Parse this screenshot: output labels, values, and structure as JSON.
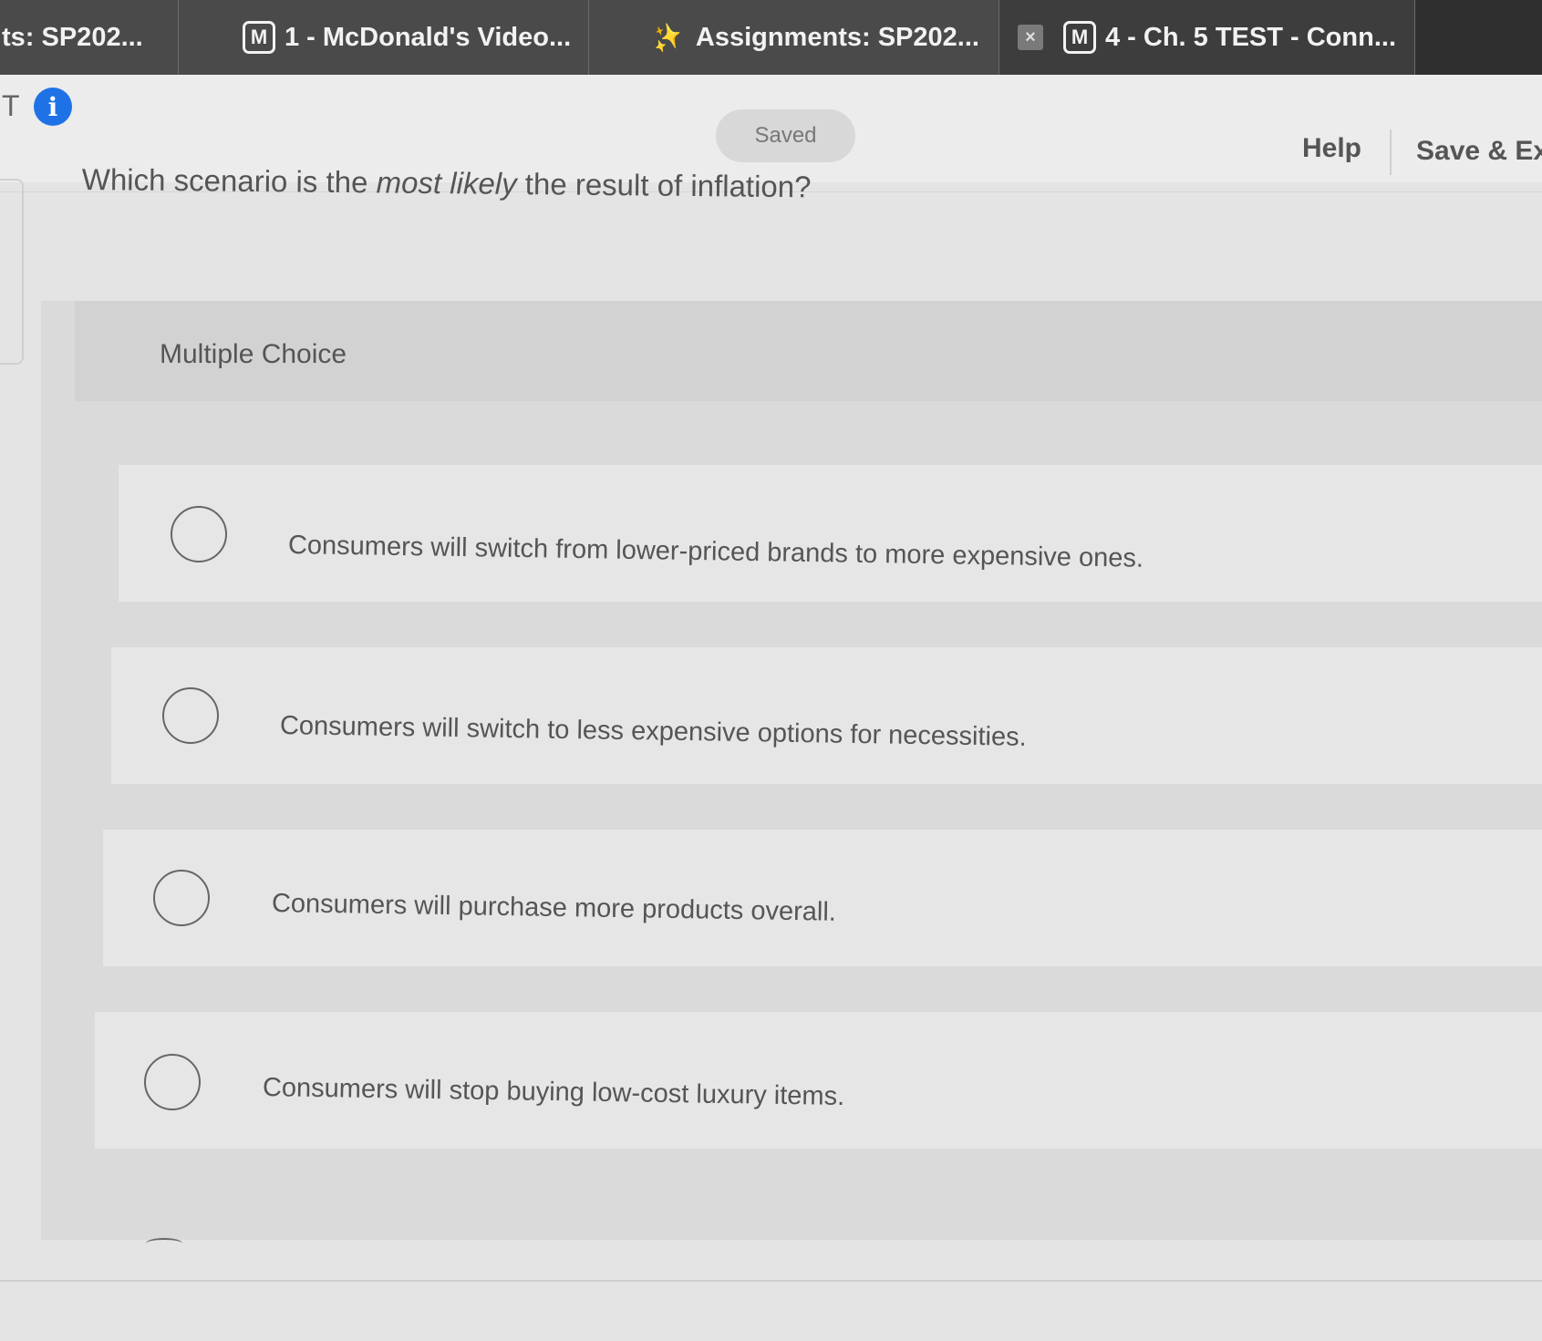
{
  "tabs": [
    {
      "label": "ts: SP202...",
      "icon": ""
    },
    {
      "label": "1 - McDonald's Video...",
      "icon": "M"
    },
    {
      "label": "Assignments: SP202...",
      "icon": "connect-logo"
    },
    {
      "label": "4 - Ch. 5 TEST - Conn...",
      "icon": "M",
      "close": "×"
    }
  ],
  "header": {
    "t_glyph": "T",
    "info_icon": "i",
    "saved": "Saved",
    "help": "Help",
    "save_exit": "Save & Ex"
  },
  "question": {
    "before": "Which scenario is the ",
    "emphasis": "most likely",
    "after": " the result of inflation?"
  },
  "answer_type": "Multiple Choice",
  "options": [
    "Consumers will switch from lower-priced brands to more expensive ones.",
    "Consumers will switch to less expensive options for necessities.",
    "Consumers will purchase more products overall.",
    "Consumers will stop buying low-cost luxury items."
  ],
  "colors": {
    "tab_bar": "#4a4a4a",
    "info_blue": "#1f72e6",
    "background": "#e4e4e4"
  }
}
